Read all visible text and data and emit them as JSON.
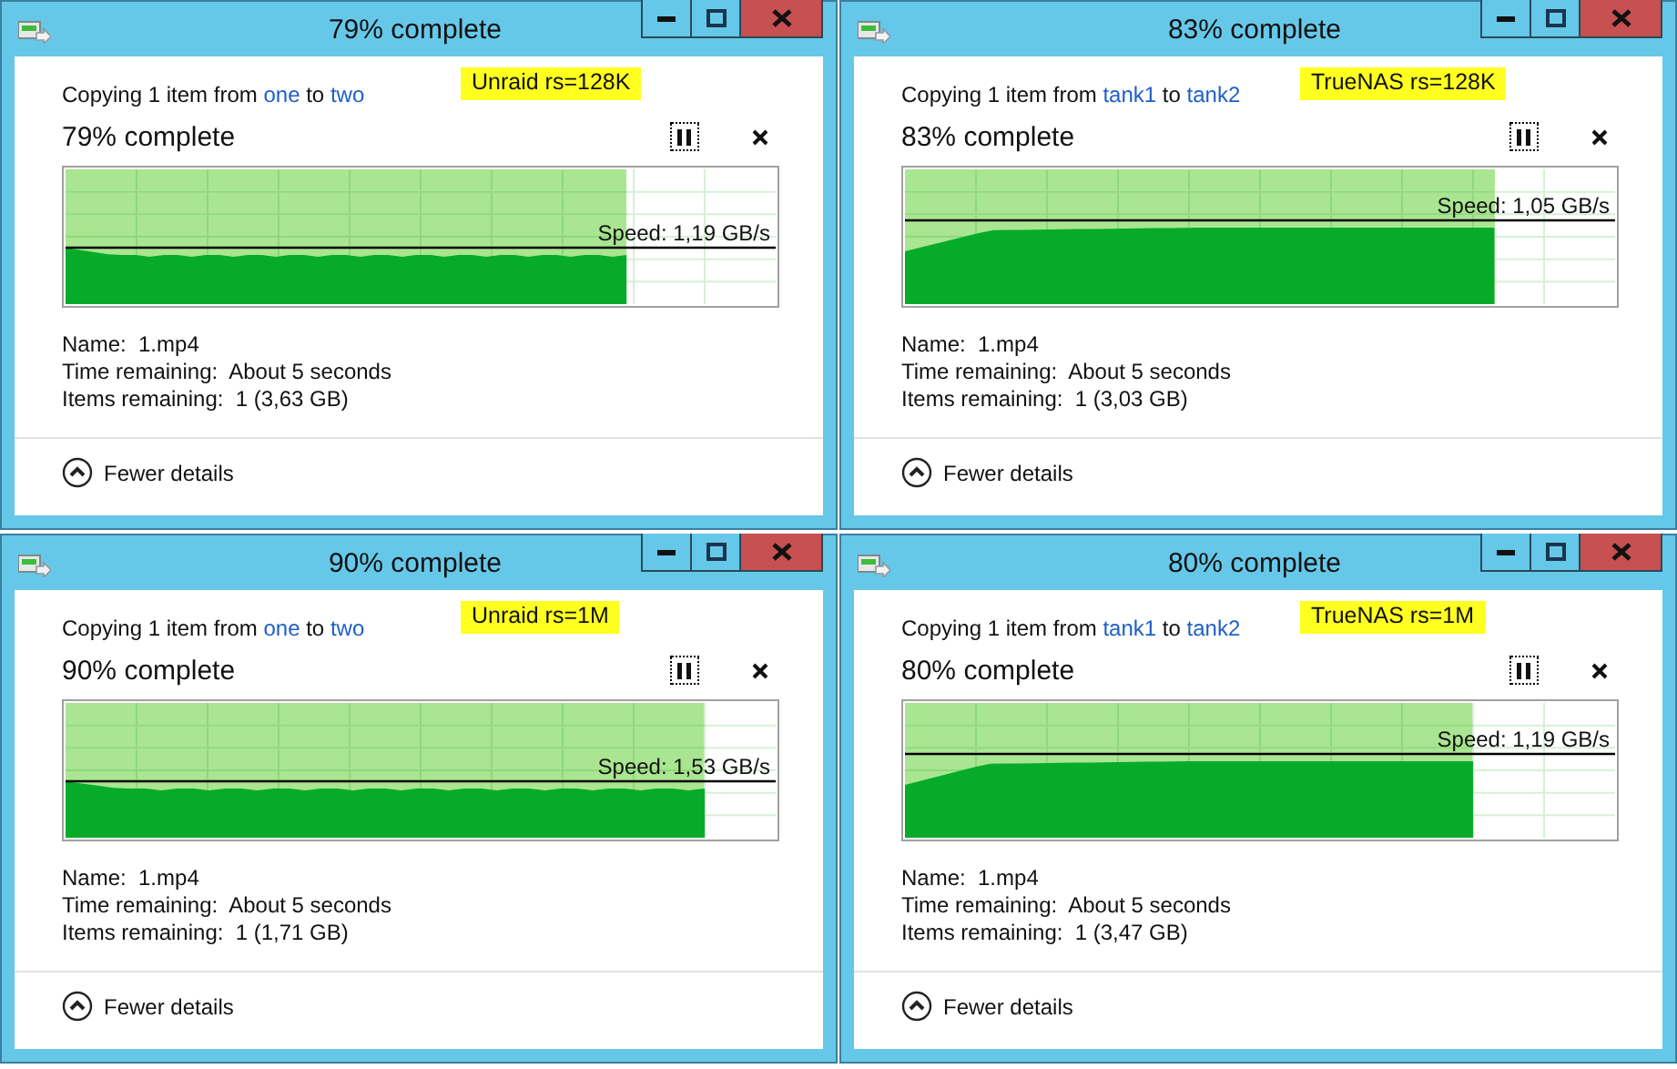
{
  "dialogs": [
    {
      "title": "79% complete",
      "note": "Unraid rs=128K",
      "copy": {
        "prefix": "Copying 1 item from",
        "source": "one",
        "middle": "to",
        "destination": "two"
      },
      "status": "79% complete",
      "level": 0.79,
      "speed": "Speed: 1,19 GB/s",
      "details": [
        "Name:  1.mp4",
        "Time remaining:  About 5 seconds",
        "Items remaining:  1 (3,63 GB)"
      ],
      "toggle": "Fewer details"
    },
    {
      "title": "83% complete",
      "note": "TrueNAS rs=128K",
      "copy": {
        "prefix": "Copying 1 item from",
        "source": "tank1",
        "middle": "to",
        "destination": "tank2"
      },
      "status": "83% complete",
      "level": 0.83,
      "speed": "Speed: 1,05 GB/s",
      "details": [
        "Name:  1.mp4",
        "Time remaining:  About 5 seconds",
        "Items remaining:  1 (3,03 GB)"
      ],
      "toggle": "Fewer details"
    },
    {
      "title": "90% complete",
      "note": "Unraid rs=1M",
      "copy": {
        "prefix": "Copying 1 item from",
        "source": "one",
        "middle": "to",
        "destination": "two"
      },
      "status": "90% complete",
      "level": 0.9,
      "speed": "Speed: 1,53 GB/s",
      "details": [
        "Name:  1.mp4",
        "Time remaining:  About 5 seconds",
        "Items remaining:  1 (1,71 GB)"
      ],
      "toggle": "Fewer details"
    },
    {
      "title": "80% complete",
      "note": "TrueNAS rs=1M",
      "copy": {
        "prefix": "Copying 1 item from",
        "source": "tank1",
        "middle": "to",
        "destination": "tank2"
      },
      "status": "80% complete",
      "level": 0.8,
      "speed": "Speed: 1,19 GB/s",
      "details": [
        "Name:  1.mp4",
        "Time remaining:  About 5 seconds",
        "Items remaining:  1 (3,47 GB)"
      ],
      "toggle": "Fewer details"
    }
  ]
}
